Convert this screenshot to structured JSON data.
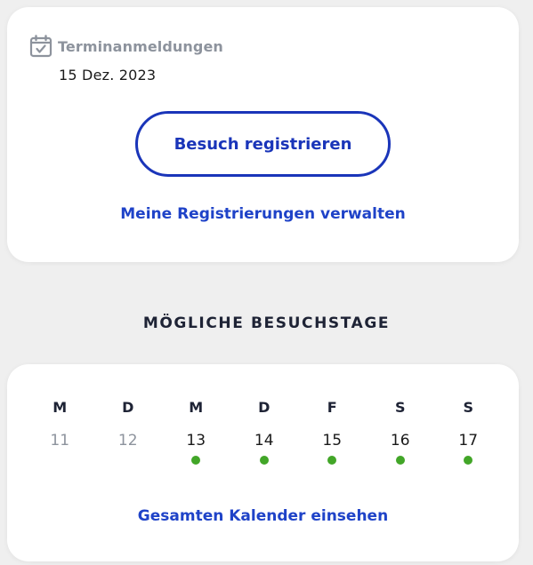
{
  "registration": {
    "heading": "Terminanmeldungen",
    "icon": "calendar-check-icon",
    "date": "15 Dez. 2023",
    "primary_button": "Besuch registrieren",
    "manage_link": "Meine Registrierungen verwalten"
  },
  "visit_days": {
    "title": "MÖGLICHE BESUCHSTAGE",
    "days": [
      {
        "letter": "M",
        "number": "11",
        "available": false
      },
      {
        "letter": "D",
        "number": "12",
        "available": false
      },
      {
        "letter": "M",
        "number": "13",
        "available": true
      },
      {
        "letter": "D",
        "number": "14",
        "available": true
      },
      {
        "letter": "F",
        "number": "15",
        "available": true
      },
      {
        "letter": "S",
        "number": "16",
        "available": true
      },
      {
        "letter": "S",
        "number": "17",
        "available": true
      }
    ],
    "calendar_link": "Gesamten Kalender einsehen"
  },
  "colors": {
    "accent": "#1a35b9",
    "link": "#1f43c8",
    "available_dot": "#42a628",
    "muted": "#8d939d"
  }
}
